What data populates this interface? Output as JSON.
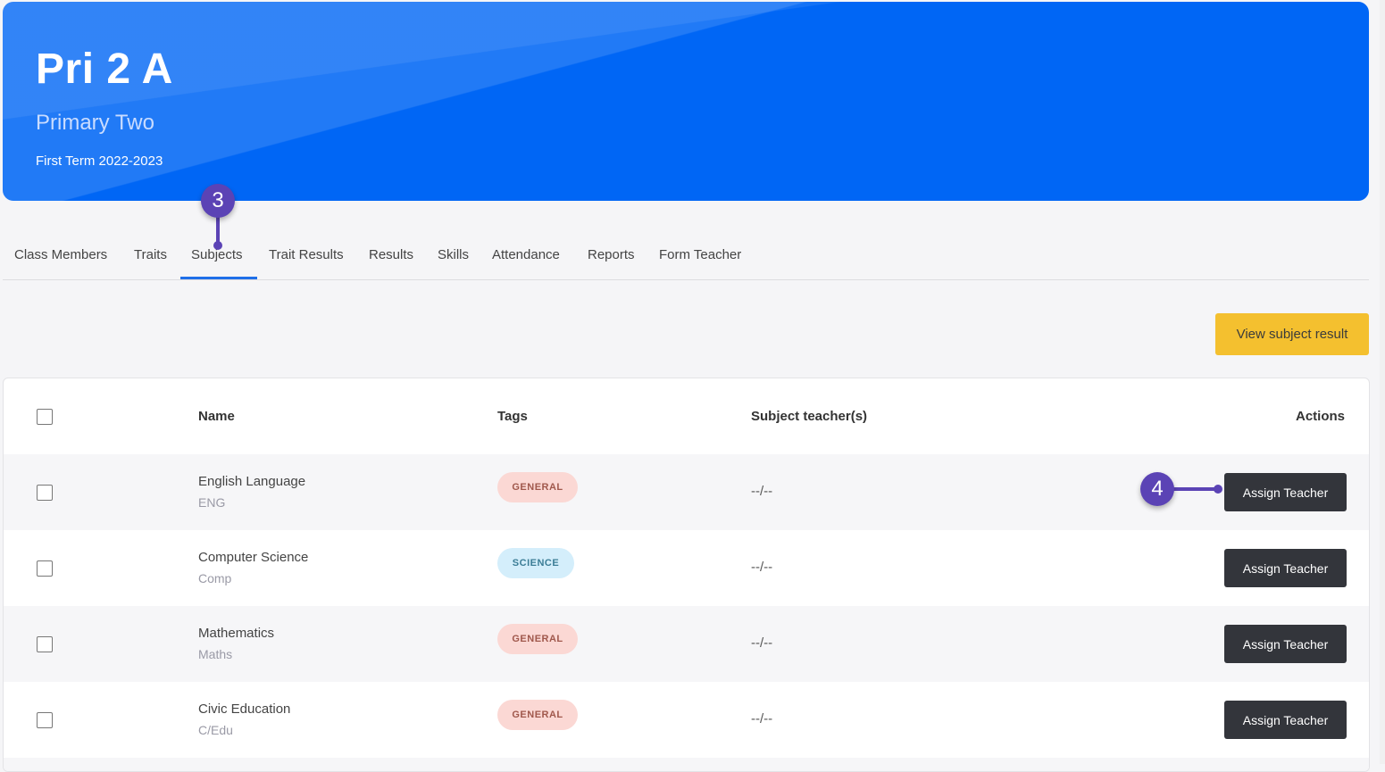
{
  "header": {
    "title": "Pri 2 A",
    "subtitle": "Primary Two",
    "term": "First Term 2022-2023",
    "color": "#0066f5"
  },
  "tabs": [
    {
      "label": "Class Members"
    },
    {
      "label": "Traits"
    },
    {
      "label": "Subjects",
      "active": true
    },
    {
      "label": "Trait Results"
    },
    {
      "label": "Results"
    },
    {
      "label": "Skills"
    },
    {
      "label": "Attendance"
    },
    {
      "label": "Reports"
    },
    {
      "label": "Form Teacher"
    }
  ],
  "markers": {
    "step3": "3",
    "step4": "4"
  },
  "actions": {
    "view_subject_result": "View subject result"
  },
  "table": {
    "columns": {
      "name": "Name",
      "tags": "Tags",
      "teachers": "Subject teacher(s)",
      "actions": "Actions"
    },
    "rows": [
      {
        "name": "English Language",
        "code": "ENG",
        "tag": "GENERAL",
        "tag_type": "general",
        "teacher": "--/--",
        "action": "Assign Teacher"
      },
      {
        "name": "Computer Science",
        "code": "Comp",
        "tag": "SCIENCE",
        "tag_type": "science",
        "teacher": "--/--",
        "action": "Assign Teacher"
      },
      {
        "name": "Mathematics",
        "code": "Maths",
        "tag": "GENERAL",
        "tag_type": "general",
        "teacher": "--/--",
        "action": "Assign Teacher"
      },
      {
        "name": "Civic Education",
        "code": "C/Edu",
        "tag": "GENERAL",
        "tag_type": "general",
        "teacher": "--/--",
        "action": "Assign Teacher"
      }
    ]
  }
}
